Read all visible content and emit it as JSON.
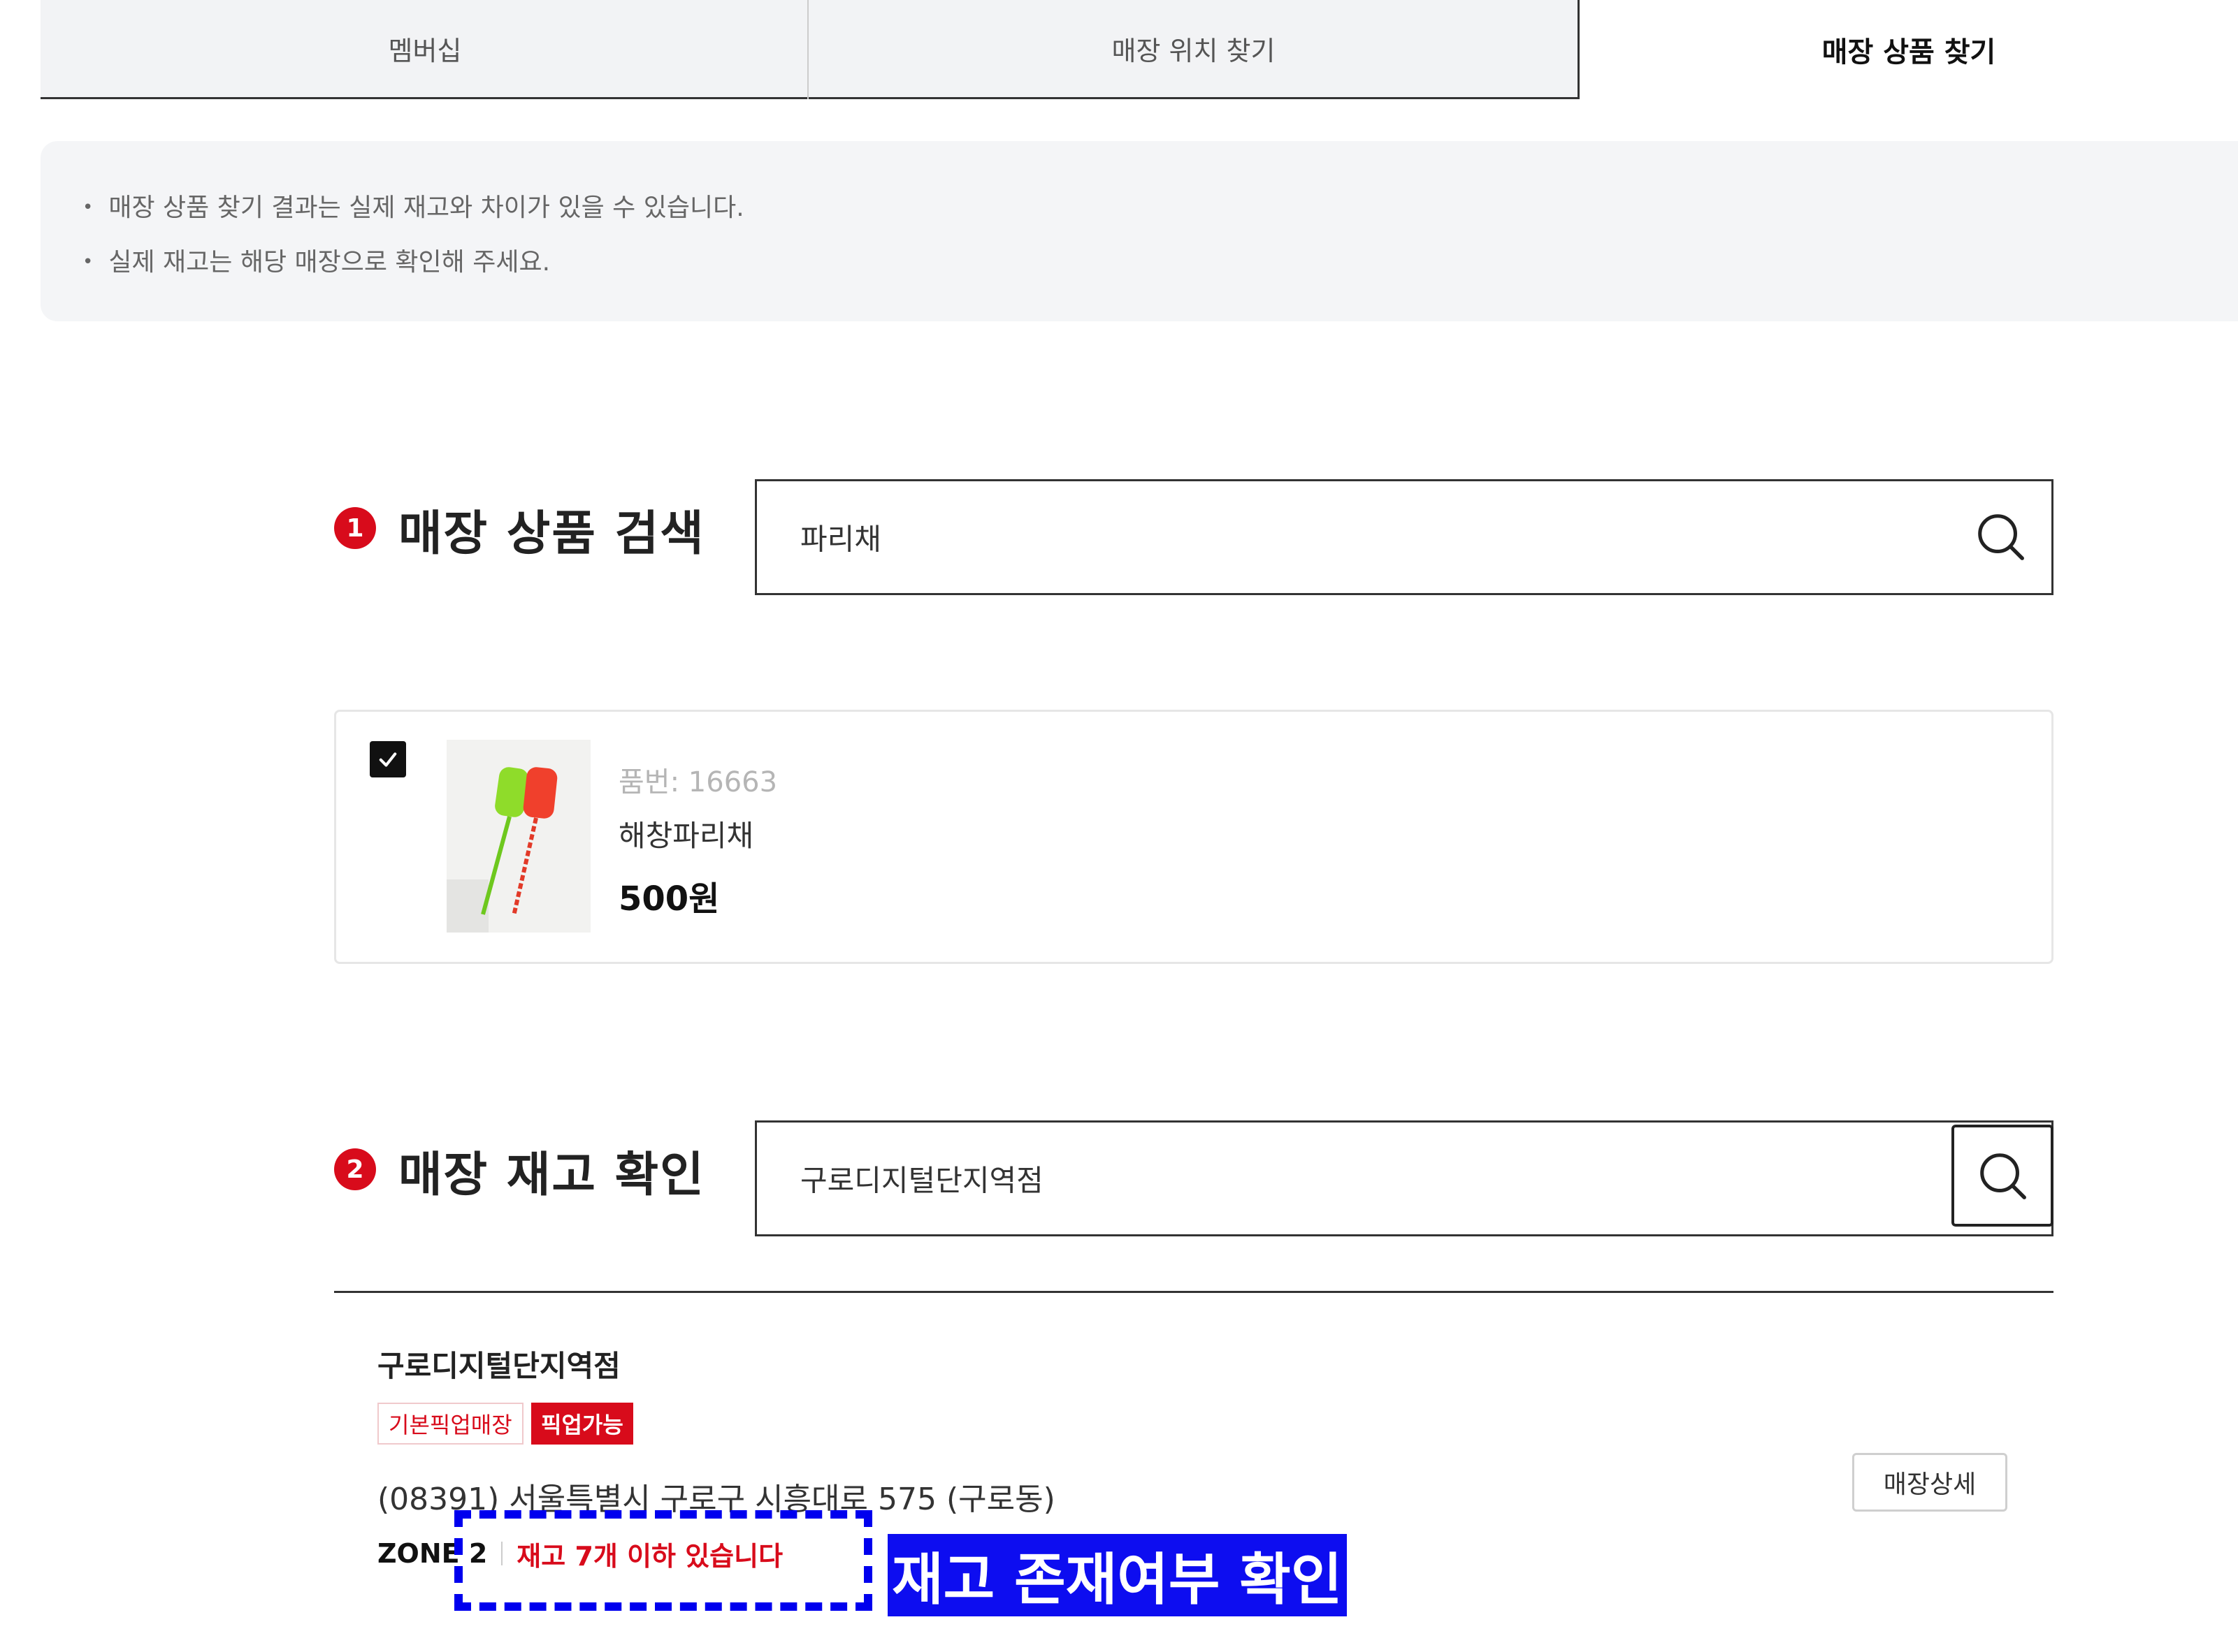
{
  "tabs": [
    {
      "label": "멤버십",
      "active": false
    },
    {
      "label": "매장 위치 찾기",
      "active": false
    },
    {
      "label": "매장 상품 찾기",
      "active": true
    }
  ],
  "notice": {
    "lines": [
      "매장 상품 찾기 결과는 실제 재고와 차이가 있을 수 있습니다.",
      "실제 재고는 해당 매장으로 확인해 주세요."
    ]
  },
  "section1": {
    "number": "1",
    "title": "매장 상품 검색",
    "search_value": "파리채"
  },
  "product": {
    "checked": true,
    "code": "품번: 16663",
    "name": "해창파리채",
    "price": "500원"
  },
  "section2": {
    "number": "2",
    "title": "매장 재고 확인",
    "search_value": "구로디지털단지역점"
  },
  "store": {
    "name": "구로디지털단지역점",
    "badges": [
      "기본픽업매장",
      "픽업가능"
    ],
    "address": "(08391) 서울특별시 구로구 시흥대로 575 (구로동)",
    "zone": "ZONE 2",
    "stock_status": "재고 7개 이하 있습니다",
    "detail_button": "매장상세"
  },
  "annotation": {
    "label": "재고 존재여부 확인"
  },
  "colors": {
    "accent_red": "#d80b1b",
    "annotation_blue": "#0d0df0",
    "tab_inactive_bg": "#f2f3f5",
    "notice_bg": "#f4f5f7"
  },
  "icons": {
    "search": "search-icon",
    "checkbox": "check-icon"
  }
}
